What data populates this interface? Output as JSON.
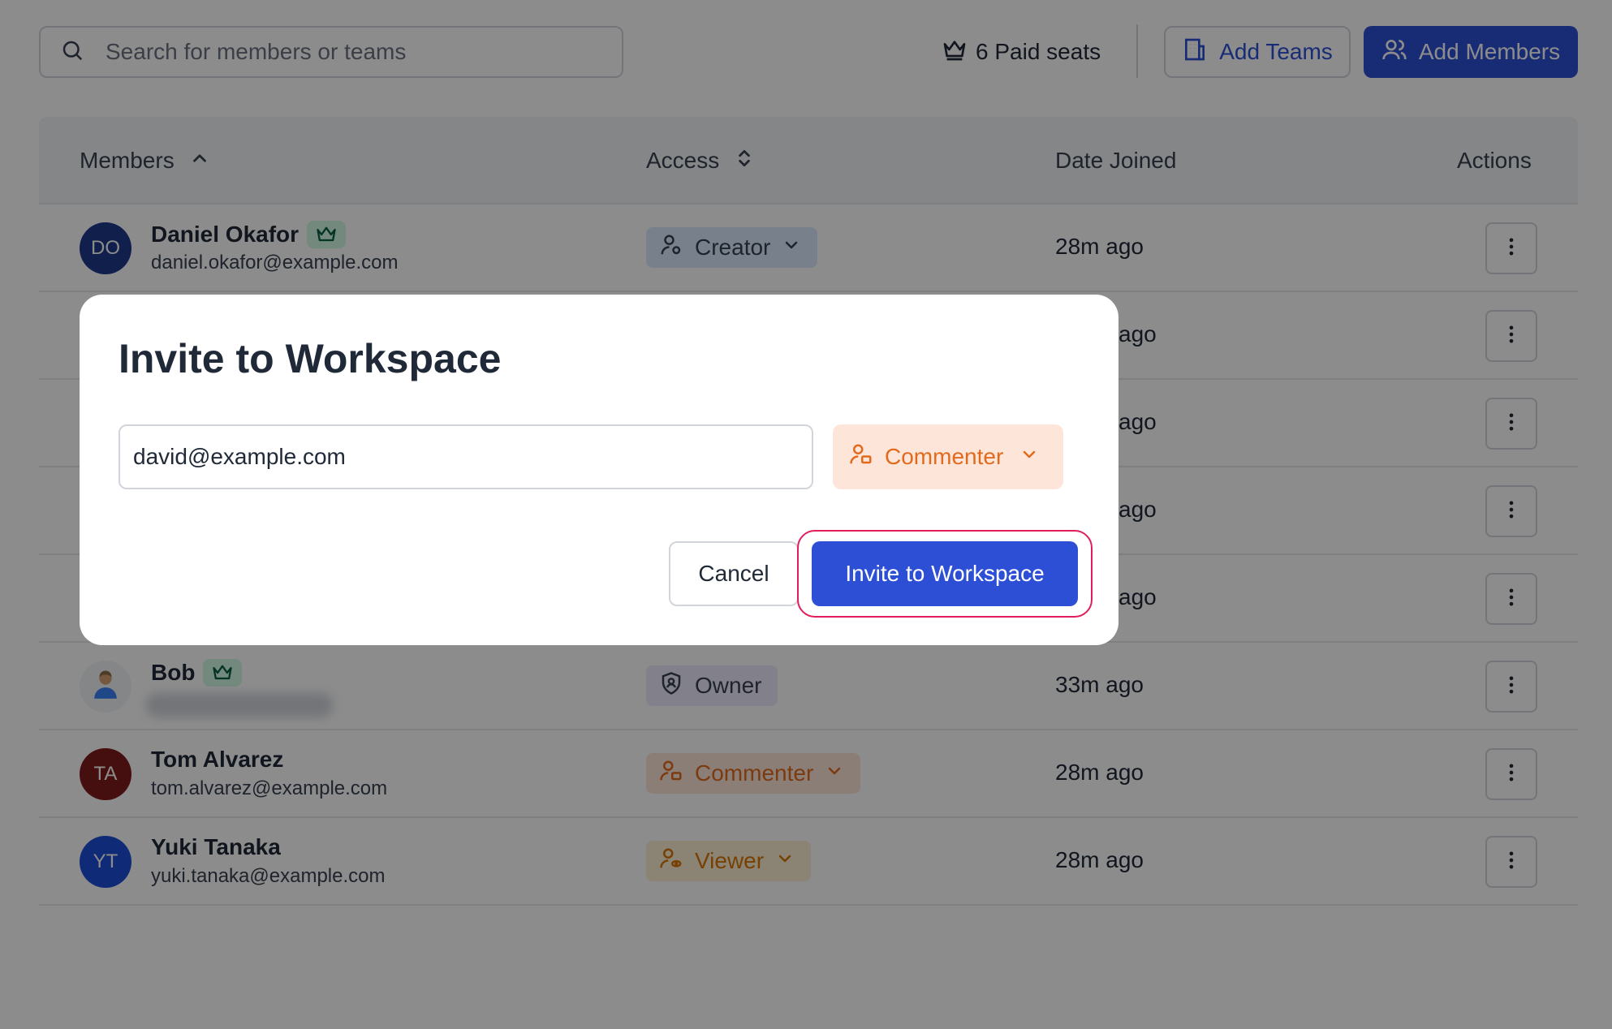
{
  "toolbar": {
    "search_placeholder": "Search for members or teams",
    "paid_seats": "6 Paid seats",
    "add_teams": "Add Teams",
    "add_members": "Add Members"
  },
  "table": {
    "headers": {
      "members": "Members",
      "access": "Access",
      "date_joined": "Date Joined",
      "actions": "Actions"
    },
    "rows": [
      {
        "initials": "DO",
        "name": "Daniel Okafor",
        "email": "daniel.okafor@example.com",
        "access": "Creator",
        "date": "28m ago"
      },
      {
        "date": "ago"
      },
      {
        "date": "ago"
      },
      {
        "date": "ago"
      },
      {
        "date": "ago"
      },
      {
        "name": "Bob",
        "access": "Owner",
        "date": "33m ago"
      },
      {
        "initials": "TA",
        "name": "Tom Alvarez",
        "email": "tom.alvarez@example.com",
        "access": "Commenter",
        "date": "28m ago"
      },
      {
        "initials": "YT",
        "name": "Yuki Tanaka",
        "email": "yuki.tanaka@example.com",
        "access": "Viewer",
        "date": "28m ago"
      }
    ]
  },
  "modal": {
    "title": "Invite to Workspace",
    "email_value": "david@example.com",
    "role": "Commenter",
    "cancel": "Cancel",
    "invite": "Invite to Workspace"
  },
  "colors": {
    "accent": "#2c4fd6",
    "commenter": "#e26a1d",
    "highlight_ring": "#e11d5a"
  }
}
